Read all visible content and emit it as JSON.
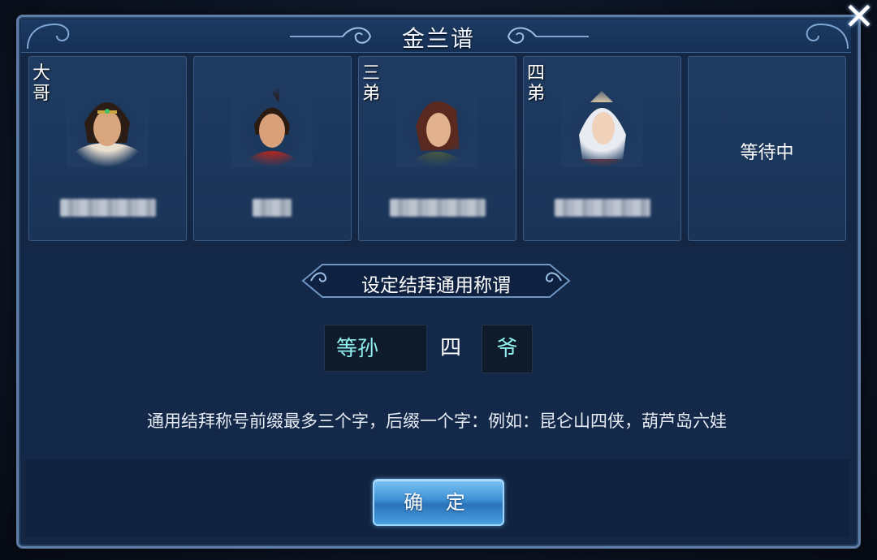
{
  "window": {
    "title": "金兰谱",
    "close_glyph": "✕"
  },
  "members": [
    {
      "rank": "大哥",
      "status": ""
    },
    {
      "rank": "",
      "status": ""
    },
    {
      "rank": "三弟",
      "status": ""
    },
    {
      "rank": "四弟",
      "status": ""
    },
    {
      "rank": "",
      "status": "等待中"
    }
  ],
  "title_setting": {
    "heading": "设定结拜通用称谓",
    "prefix_value": "等孙",
    "middle_char": "四",
    "suffix_value": "爷",
    "hint": "通用结拜称号前缀最多三个字，后缀一个字：例如：昆仑山四侠，葫芦岛六娃"
  },
  "confirm_label": "确 定",
  "colors": {
    "panel_bg": "#142845",
    "accent_cyan": "#8ff0ee",
    "button_blue": "#3c8fd4"
  }
}
